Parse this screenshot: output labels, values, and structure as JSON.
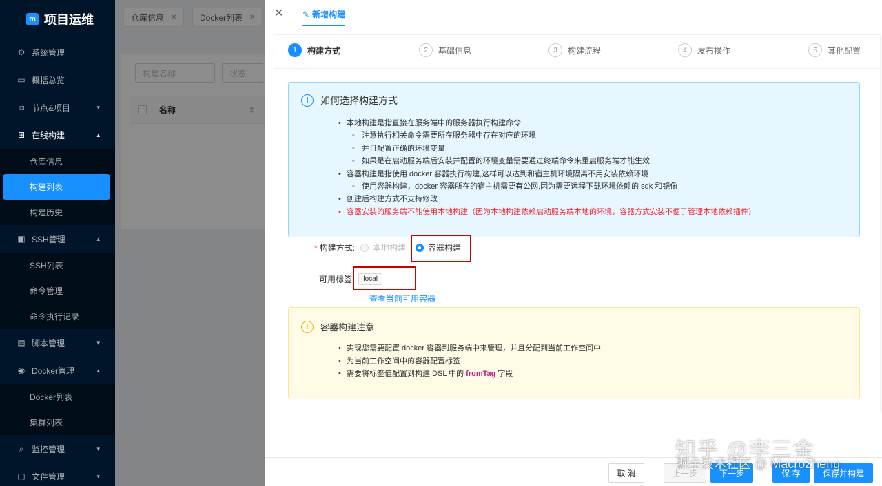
{
  "app": {
    "title": "项目运维",
    "logo_mark": "m"
  },
  "sidebar": {
    "items": [
      {
        "label": "系统管理",
        "icon": "gear-icon",
        "glyph": "⚙"
      },
      {
        "label": "概括总览",
        "icon": "monitor-icon",
        "glyph": "▭"
      },
      {
        "label": "节点&项目",
        "icon": "nodes-icon",
        "glyph": "⧉",
        "chev": "▾"
      },
      {
        "label": "在线构建",
        "icon": "build-icon",
        "glyph": "⊞",
        "chev": "▴"
      },
      {
        "label": "SSH管理",
        "icon": "terminal-icon",
        "glyph": "▣",
        "chev": "▴"
      },
      {
        "label": "脚本管理",
        "icon": "file-icon",
        "glyph": "▤",
        "chev": "▾"
      },
      {
        "label": "Docker管理",
        "icon": "docker-icon",
        "glyph": "◉",
        "chev": "▴"
      },
      {
        "label": "监控管理",
        "icon": "monitor-search-icon",
        "glyph": "⌕",
        "chev": "▾"
      },
      {
        "label": "文件管理",
        "icon": "folder-icon",
        "glyph": "▢",
        "chev": "▾"
      }
    ],
    "build_sub": [
      "仓库信息",
      "构建列表",
      "构建历史"
    ],
    "ssh_sub": [
      "SSH列表",
      "命令管理",
      "命令执行记录"
    ],
    "docker_sub": [
      "Docker列表",
      "集群列表"
    ]
  },
  "tabs": [
    {
      "label": "仓库信息",
      "close": "✕"
    },
    {
      "label": "Docker列表",
      "close": "✕"
    }
  ],
  "behind": {
    "search_placeholder": "构建名称",
    "status_placeholder": "状态",
    "col_name": "名称",
    "sort_icon": "⇕"
  },
  "drawer": {
    "close": "✕",
    "title": "新增构建",
    "title_icon": "✎",
    "steps": [
      {
        "num": "1",
        "label": "构建方式"
      },
      {
        "num": "2",
        "label": "基础信息"
      },
      {
        "num": "3",
        "label": "构建流程"
      },
      {
        "num": "4",
        "label": "发布操作"
      },
      {
        "num": "5",
        "label": "其他配置"
      }
    ],
    "info": {
      "icon": "i",
      "title": "如何选择构建方式",
      "lines": [
        "本地构建是指直接在服务端中的服务器执行构建命令",
        "注意执行相关命令需要所在服务器中存在对应的环境",
        "并且配置正确的环境变量",
        "如果是在启动服务端后安装并配置的环境变量需要通过终端命令来重启服务端才能生效",
        "容器构建是指使用 docker 容器执行构建,这样可以达到和宿主机环境隔离不用安装依赖环境",
        "使用容器构建，docker 容器所在的宿主机需要有公网,因为需要远程下载环境依赖的 sdk 和镜像",
        "创建后构建方式不支持修改",
        "容器安装的服务端不能使用本地构建（因为本地构建依赖启动服务端本地的环境，容器方式安装不便于管理本地依赖插件）"
      ]
    },
    "form": {
      "build_mode_label": "构建方式:",
      "required_mark": "*",
      "option_local": "本地构建",
      "option_container": "容器构建",
      "tags_label": "可用标签:",
      "tag": "local",
      "view_link": "查看当前可用容器"
    },
    "warn": {
      "icon": "!",
      "title": "容器构建注意",
      "line1": "实现您需要配置 docker 容器到服务端中来管理，并且分配到当前工作空间中",
      "line2": "为当前工作空间中的容器配置标签",
      "line3_pre": "需要将标签值配置到构建 DSL 中的 ",
      "line3_code": "fromTag",
      "line3_post": " 字段"
    },
    "footer": {
      "cancel": "取 消",
      "prev": "上一步",
      "next": "下一步",
      "save": "保 存",
      "save_build": "保存并构建"
    }
  },
  "watermark": {
    "line1": "知乎 @李三金",
    "line2": "掘金技术社区 @ MacroZheng"
  }
}
